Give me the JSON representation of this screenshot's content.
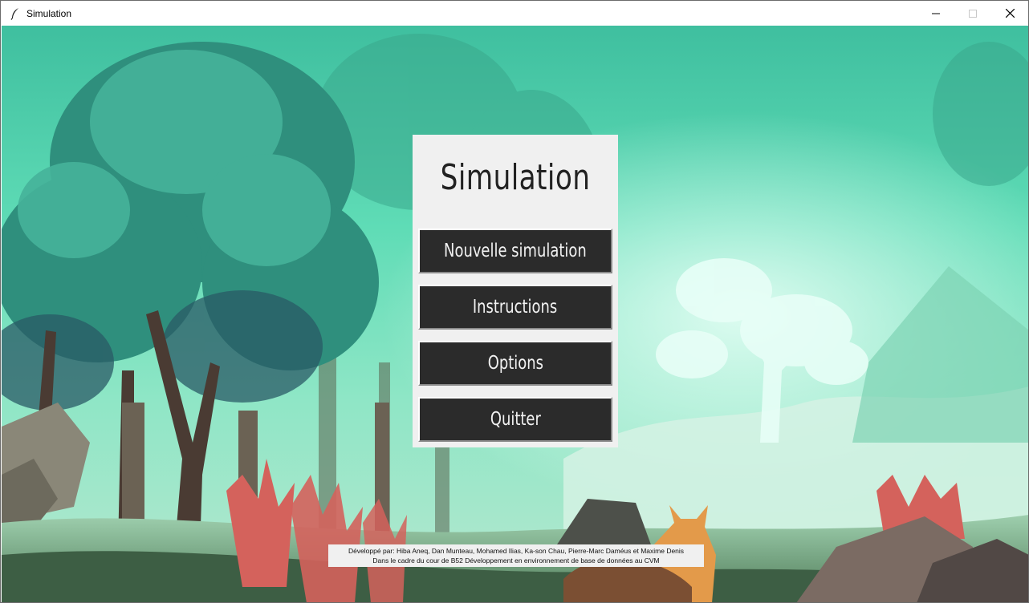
{
  "window": {
    "title": "Simulation"
  },
  "menu": {
    "title": "Simulation",
    "buttons": {
      "new_simulation": "Nouvelle simulation",
      "instructions": "Instructions",
      "options": "Options",
      "quit": "Quitter"
    }
  },
  "credits": {
    "line1": "Développé par: Hiba Aneq, Dan Munteau, Mohamed Ilias, Ka-son Chau, Pierre-Marc Daméus et Maxime Denis",
    "line2": "Dans le cadre du cour de B52 Développement en environnement de base de données au CVM"
  },
  "icons": {
    "app": "feather-icon",
    "minimize": "minimize-icon",
    "maximize": "maximize-icon",
    "close": "close-icon"
  },
  "colors": {
    "panel": "#f0f0f0",
    "button": "#2b2b2b",
    "button_text": "#f2f2f2",
    "sky": "#5fd9b5"
  }
}
